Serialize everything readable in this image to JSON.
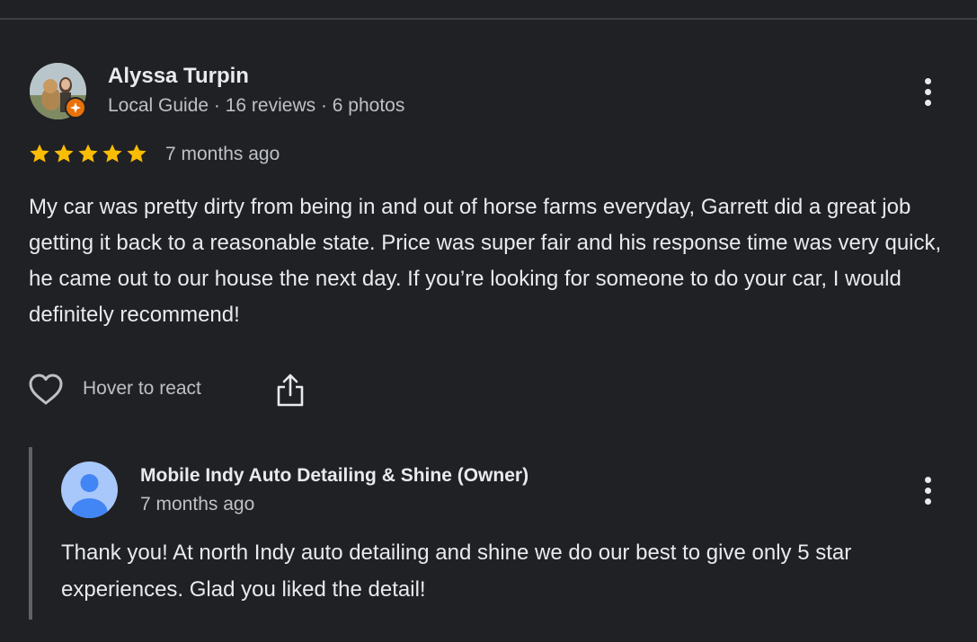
{
  "review": {
    "author": {
      "name": "Alyssa Turpin",
      "meta": "Local Guide · 16 reviews · 6 photos"
    },
    "rating": 5,
    "date": "7 months ago",
    "text": "My car was pretty dirty from being in and out of horse farms everyday, Garrett did a great job getting it back to a reasonable state. Price was super fair and his response time was very quick, he came out to our house the next day. If you’re looking for someone to do your car, I would definitely recommend!",
    "actions": {
      "react_label": "Hover to react",
      "react_icon": "heart-outline-icon",
      "share_icon": "share-icon",
      "more_icon": "more-vert-icon"
    }
  },
  "owner_reply": {
    "name": "Mobile Indy Auto Detailing & Shine (Owner)",
    "date": "7 months ago",
    "text": "Thank you! At north Indy auto detailing and shine we do our best to give only 5 star experiences. Glad you liked the detail!",
    "avatar_icon": "default-person-avatar-icon",
    "more_icon": "more-vert-icon"
  },
  "colors": {
    "background": "#202124",
    "star": "#fbbc04",
    "local_guide_badge": "#e8710a",
    "owner_avatar_bg": "#a8c7fa",
    "owner_avatar_person": "#4285f4"
  }
}
